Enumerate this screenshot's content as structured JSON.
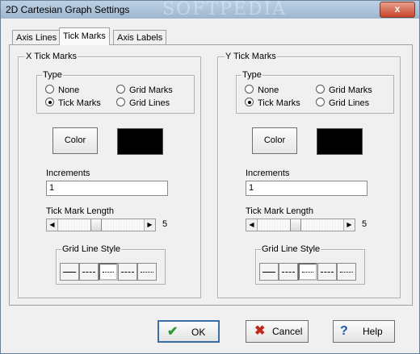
{
  "window": {
    "title": "2D Cartesian Graph Settings",
    "watermark": "SOFTPEDIA",
    "close_glyph": "x"
  },
  "tabs": [
    {
      "label": "Axis Lines",
      "active": false
    },
    {
      "label": "Tick Marks",
      "active": true
    },
    {
      "label": "Axis Labels",
      "active": false
    }
  ],
  "x_panel": {
    "title": "X Tick Marks",
    "type_label": "Type",
    "options": {
      "none": "None",
      "tick_marks": "Tick Marks",
      "grid_marks": "Grid Marks",
      "grid_lines": "Grid Lines"
    },
    "selected": "Tick Marks",
    "color_button": "Color",
    "color_value": "#000000",
    "increments_label": "Increments",
    "increments_value": "1",
    "tick_length_label": "Tick Mark Length",
    "tick_length_value": "5",
    "grid_style_label": "Grid Line Style",
    "selected_style_index": 2
  },
  "y_panel": {
    "title": "Y Tick Marks",
    "type_label": "Type",
    "options": {
      "none": "None",
      "tick_marks": "Tick Marks",
      "grid_marks": "Grid Marks",
      "grid_lines": "Grid Lines"
    },
    "selected": "Tick Marks",
    "color_button": "Color",
    "color_value": "#000000",
    "increments_label": "Increments",
    "increments_value": "1",
    "tick_length_label": "Tick Mark Length",
    "tick_length_value": "5",
    "grid_style_label": "Grid Line Style",
    "selected_style_index": 2
  },
  "footer": {
    "ok_label": "OK",
    "cancel_label": "Cancel",
    "help_label": "Help",
    "ok_icon": "✔",
    "cancel_icon": "✖",
    "help_icon": "?"
  },
  "colors": {
    "ok_icon": "#2e9a2e",
    "cancel_icon": "#c0281e",
    "help_icon": "#1e56b4",
    "selection_swatch": "#000000"
  }
}
